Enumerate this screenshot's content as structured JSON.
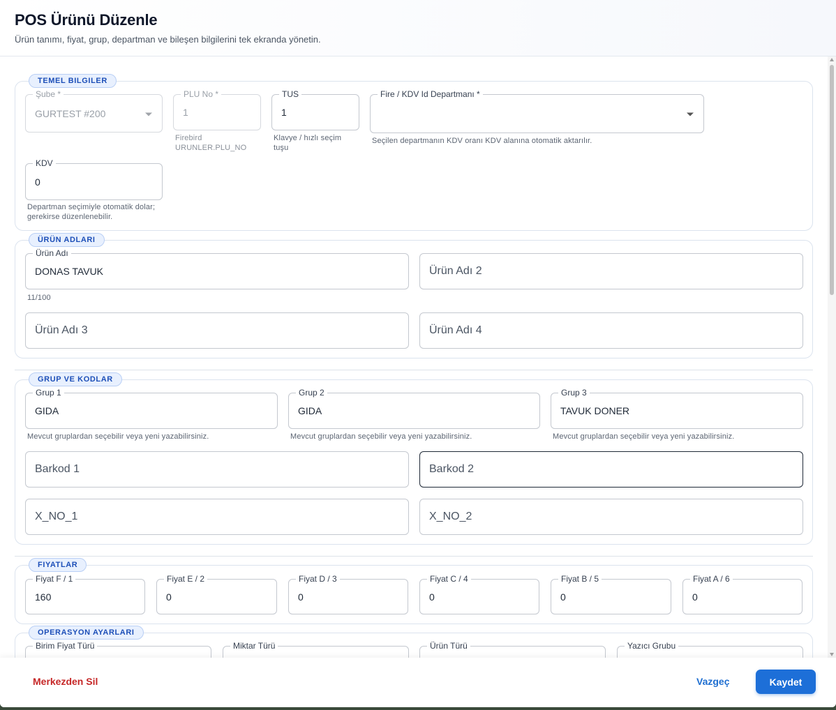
{
  "dialog": {
    "title": "POS Ürünü Düzenle",
    "subtitle": "Ürün tanımı, fiyat, grup, departman ve bileşen bilgilerini tek ekranda yönetin."
  },
  "sections": {
    "temel": {
      "chip": "TEMEL BILGILER",
      "sube": {
        "label": "Şube *",
        "value": "GURTEST #200"
      },
      "plu": {
        "label": "PLU No *",
        "value": "1",
        "help": "Firebird URUNLER.PLU_NO"
      },
      "tus": {
        "label": "TUS",
        "value": "1",
        "help": "Klavye / hızlı seçim tuşu"
      },
      "fire": {
        "label": "Fire / KDV Id Departmanı *",
        "value": "",
        "help": "Seçilen departmanın KDV oranı KDV alanına otomatik aktarılır."
      },
      "kdv": {
        "label": "KDV",
        "value": "0",
        "help": "Departman seçimiyle otomatik dolar; gerekirse düzenlenebilir."
      }
    },
    "adlar": {
      "chip": "ÜRÜN ADLARI",
      "ad1": {
        "label": "Ürün Adı",
        "value": "DONAS TAVUK",
        "counter": "11/100"
      },
      "ad2": {
        "placeholder": "Ürün Adı 2"
      },
      "ad3": {
        "placeholder": "Ürün Adı 3"
      },
      "ad4": {
        "placeholder": "Ürün Adı 4"
      }
    },
    "grup": {
      "chip": "GRUP VE KODLAR",
      "grup1": {
        "label": "Grup 1",
        "value": "GIDA",
        "help": "Mevcut gruplardan seçebilir veya yeni yazabilirsiniz."
      },
      "grup2": {
        "label": "Grup 2",
        "value": "GIDA",
        "help": "Mevcut gruplardan seçebilir veya yeni yazabilirsiniz."
      },
      "grup3": {
        "label": "Grup 3",
        "value": "TAVUK DONER",
        "help": "Mevcut gruplardan seçebilir veya yeni yazabilirsiniz."
      },
      "barkod1": {
        "placeholder": "Barkod 1"
      },
      "barkod2": {
        "placeholder": "Barkod 2"
      },
      "xno1": {
        "placeholder": "X_NO_1"
      },
      "xno2": {
        "placeholder": "X_NO_2"
      }
    },
    "fiyatlar": {
      "chip": "FIYATLAR",
      "items": [
        {
          "label": "Fiyat F / 1",
          "value": "160"
        },
        {
          "label": "Fiyat E / 2",
          "value": "0"
        },
        {
          "label": "Fiyat D / 3",
          "value": "0"
        },
        {
          "label": "Fiyat C / 4",
          "value": "0"
        },
        {
          "label": "Fiyat B / 5",
          "value": "0"
        },
        {
          "label": "Fiyat A / 6",
          "value": "0"
        }
      ]
    },
    "operasyon": {
      "chip": "OPERASYON AYARLARI",
      "birim": {
        "label": "Birim Fiyat Türü"
      },
      "miktar": {
        "label": "Miktar Türü"
      },
      "urun_turu": {
        "label": "Ürün Türü"
      },
      "yazici": {
        "label": "Yazıcı Grubu"
      }
    }
  },
  "footer": {
    "delete_label": "Merkezden Sil",
    "cancel_label": "Vazgeç",
    "save_label": "Kaydet"
  }
}
